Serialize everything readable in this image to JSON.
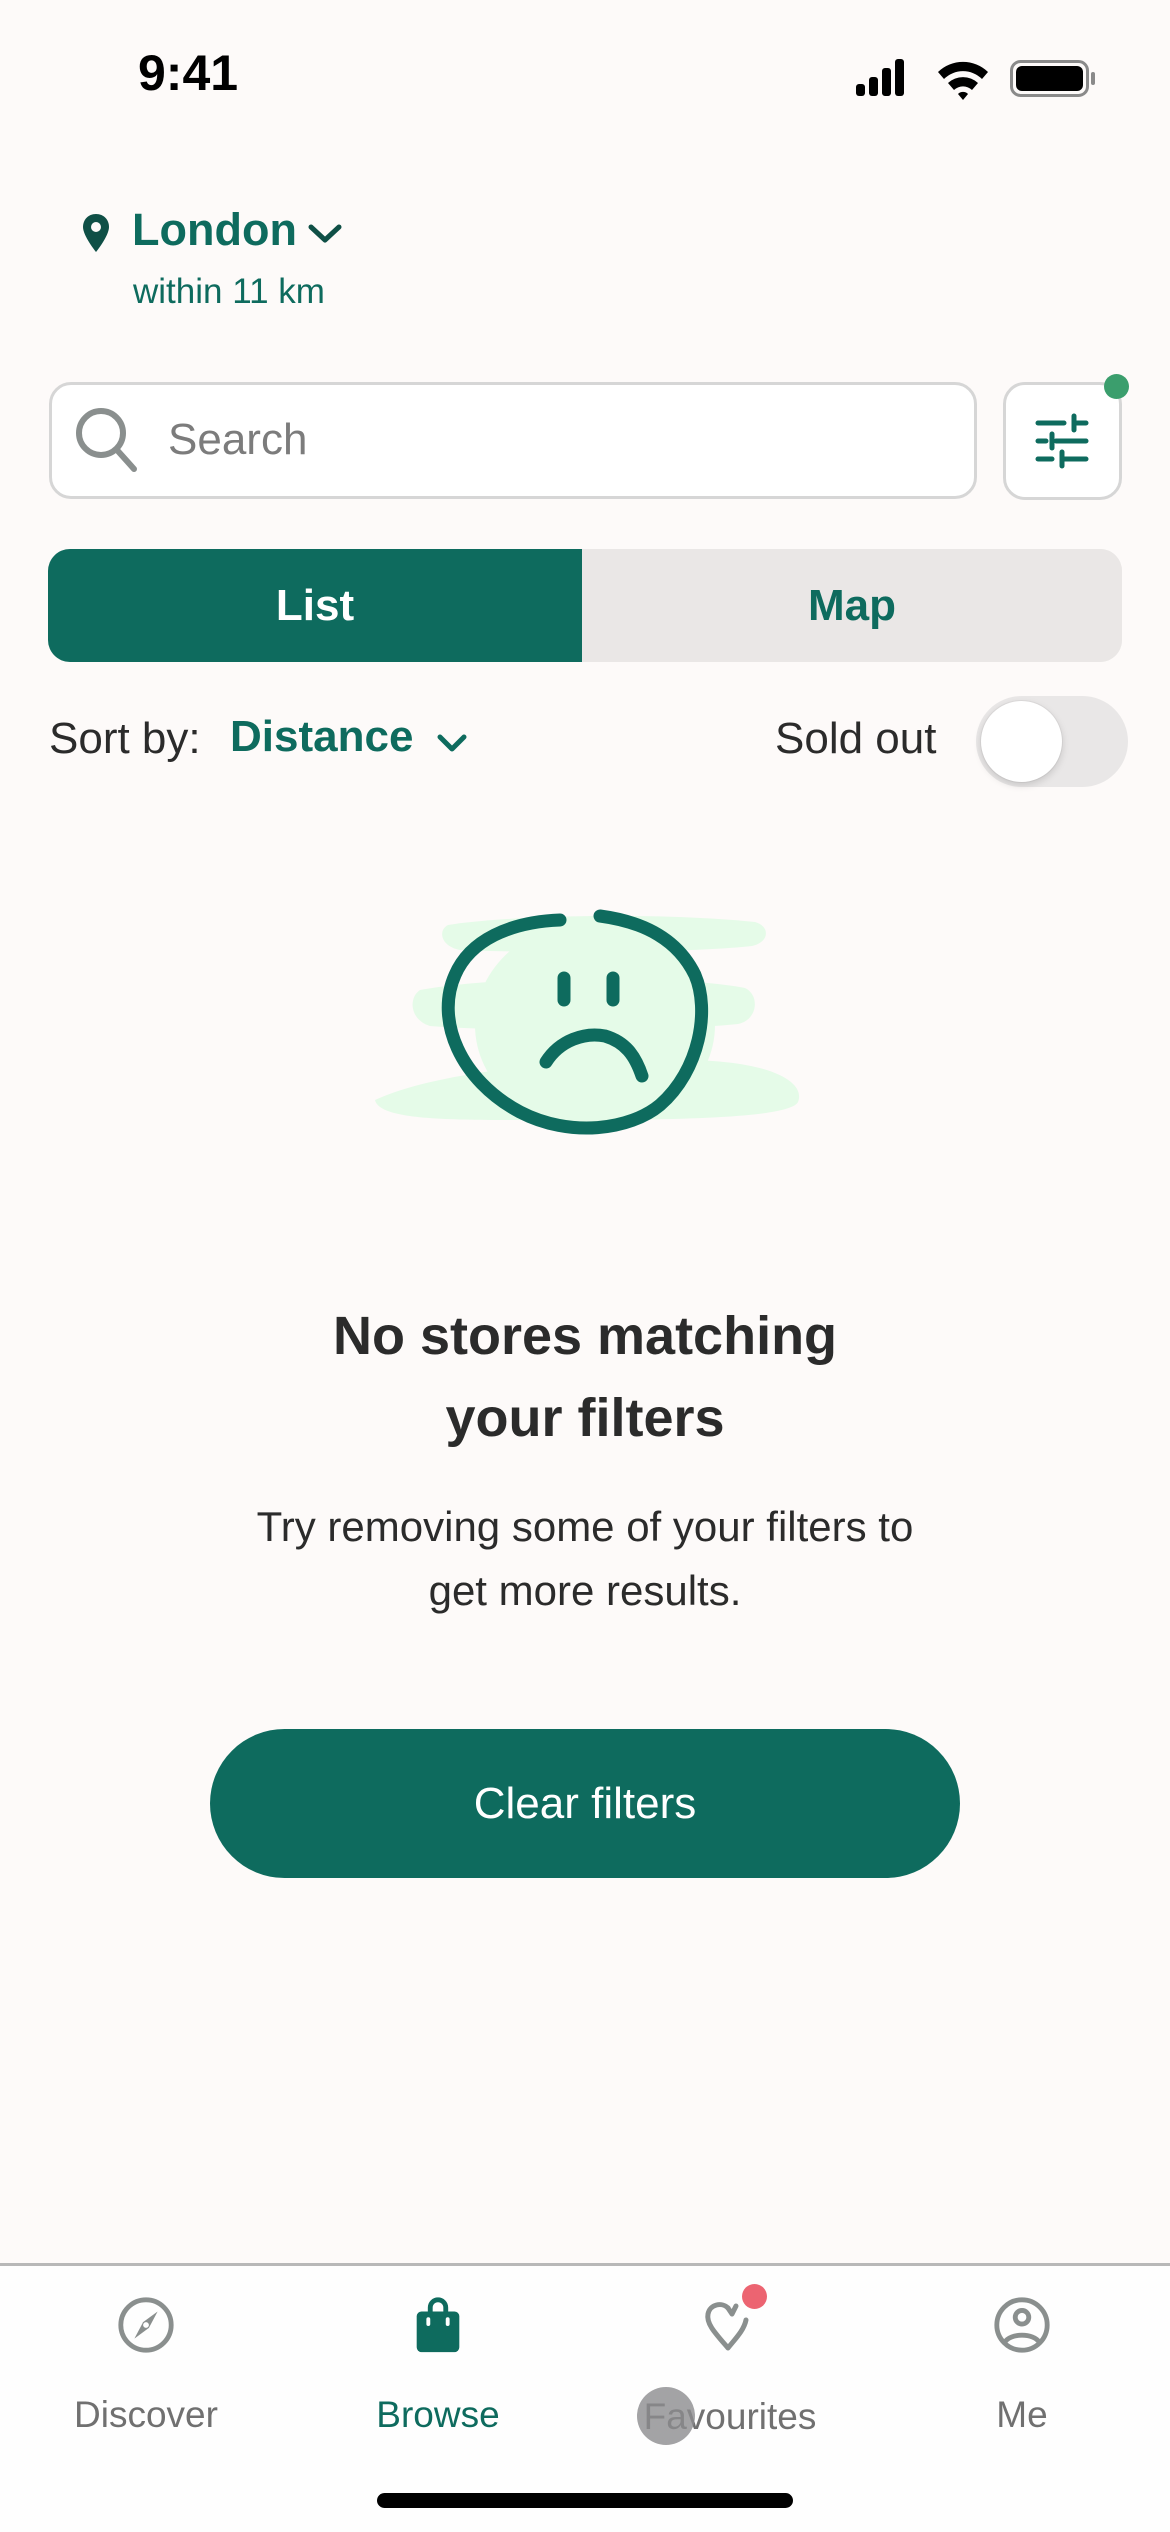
{
  "status_bar": {
    "time": "9:41",
    "icons": [
      "cellular-signal-icon",
      "wifi-icon",
      "battery-icon"
    ]
  },
  "location": {
    "icon": "map-pin-icon",
    "city": "London",
    "radius": "within 11 km",
    "chevron": "chevron-down-icon"
  },
  "search": {
    "placeholder": "Search",
    "value": "",
    "icon": "search-icon"
  },
  "filter_button": {
    "icon": "sliders-icon",
    "active_indicator": true,
    "indicator_color": "#3b9e6d"
  },
  "view_toggle": {
    "options": [
      {
        "label": "List",
        "selected": true
      },
      {
        "label": "Map",
        "selected": false
      }
    ]
  },
  "sort": {
    "label": "Sort by:",
    "value": "Distance"
  },
  "sold_out": {
    "label": "Sold out",
    "enabled": false
  },
  "empty_state": {
    "illustration": "sad-face-icon",
    "title_line1": "No stores matching",
    "title_line2": "your filters",
    "description_line1": "Try removing some of your filters to",
    "description_line2": "get more results.",
    "button_label": "Clear filters"
  },
  "tab_bar": {
    "items": [
      {
        "label": "Discover",
        "icon": "compass-icon",
        "active": false
      },
      {
        "label": "Browse",
        "icon": "shopping-bag-icon",
        "active": true
      },
      {
        "label": "Favourites",
        "icon": "heart-icon",
        "active": false,
        "badge": true
      },
      {
        "label": "Me",
        "icon": "user-circle-icon",
        "active": false
      }
    ]
  },
  "colors": {
    "brand": "#0e6b5e",
    "background": "#fdfaf9",
    "badge_red": "#ec6471",
    "illustration_fill": "#e5fbe8"
  }
}
